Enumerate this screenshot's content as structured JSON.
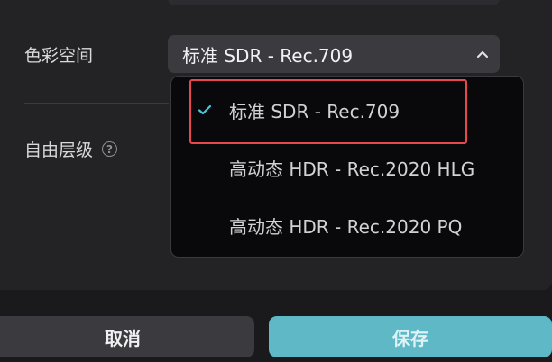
{
  "settings": {
    "color_space_label": "色彩空间",
    "free_layer_label": "自由层级",
    "help_icon": "question-icon"
  },
  "color_space_select": {
    "selected": "标准 SDR - Rec.709",
    "options": [
      {
        "label": "标准 SDR - Rec.709",
        "selected": true
      },
      {
        "label": "高动态 HDR - Rec.2020 HLG",
        "selected": false
      },
      {
        "label": "高动态 HDR - Rec.2020 PQ",
        "selected": false
      }
    ]
  },
  "footer": {
    "cancel_label": "取消",
    "save_label": "保存"
  },
  "colors": {
    "accent": "#5fb8c6",
    "check": "#4cc6d9",
    "highlight_box": "#e5484d"
  }
}
